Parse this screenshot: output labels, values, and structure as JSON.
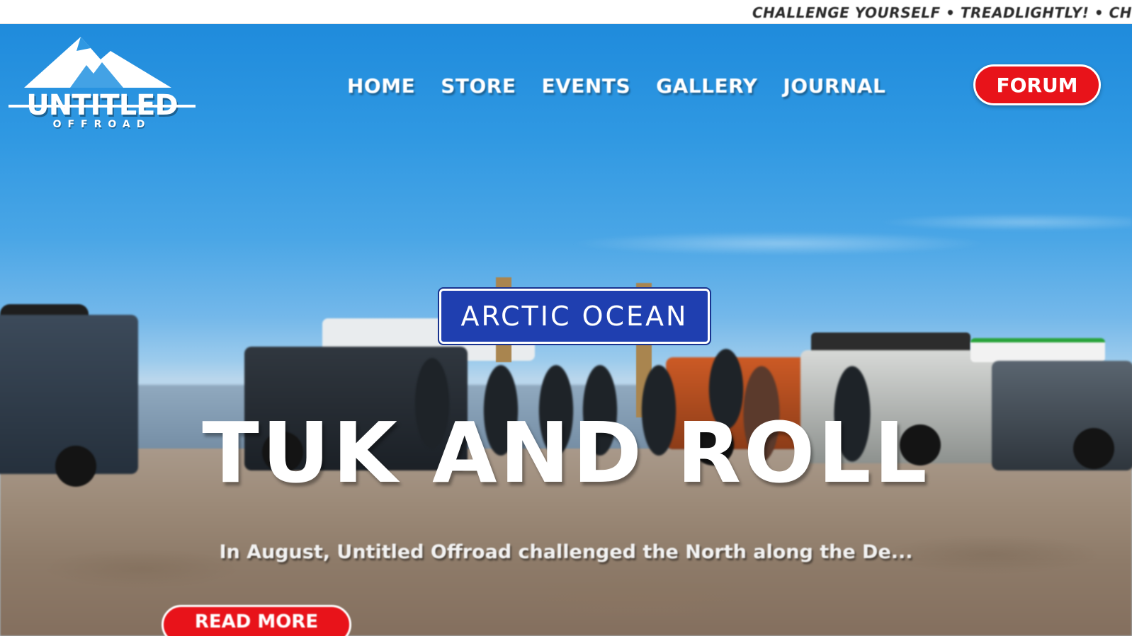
{
  "ticker": {
    "text": "CHALLENGE YOURSELF • TREADLIGHTLY! • CH"
  },
  "brand": {
    "name": "UNTITLED",
    "subtitle": "OFFROAD"
  },
  "nav": {
    "items": [
      {
        "label": "HOME"
      },
      {
        "label": "STORE"
      },
      {
        "label": "EVENTS"
      },
      {
        "label": "GALLERY"
      },
      {
        "label": "JOURNAL"
      }
    ],
    "forum_label": "FORUM"
  },
  "hero": {
    "sign_text": "ARCTIC OCEAN",
    "headline": "TUK AND ROLL",
    "excerpt": "In August, Untitled Offroad challenged the North along the De...",
    "cta_label": "READ MORE"
  },
  "colors": {
    "accent_red": "#e8131a",
    "sky_blue": "#2f98e2",
    "sign_blue": "#1f3fb0"
  },
  "icons": {
    "logo": "mountain-logo-icon"
  }
}
